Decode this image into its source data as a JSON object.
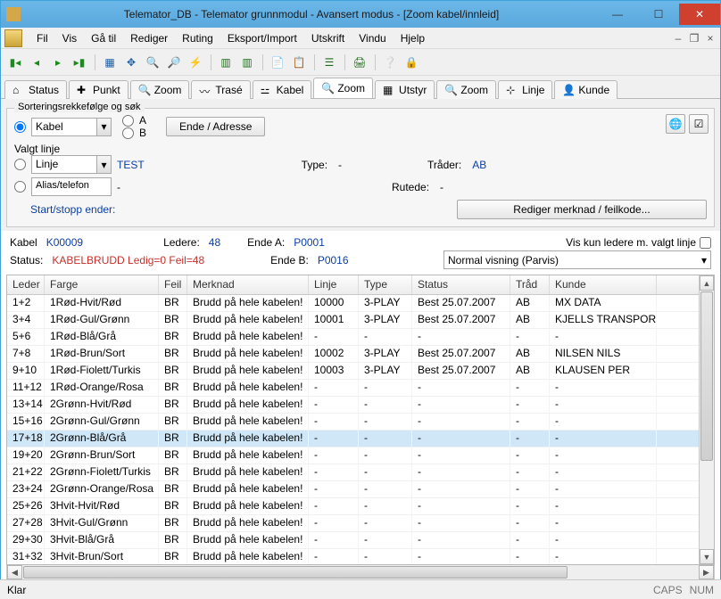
{
  "window": {
    "title": "Telemator_DB - Telemator grunnmodul - Avansert modus - [Zoom kabel/innleid]"
  },
  "menu": [
    "Fil",
    "Vis",
    "Gå til",
    "Rediger",
    "Ruting",
    "Eksport/Import",
    "Utskrift",
    "Vindu",
    "Hjelp"
  ],
  "tabs": [
    {
      "icon": "home",
      "label": "Status"
    },
    {
      "icon": "plus",
      "label": "Punkt"
    },
    {
      "icon": "zoom",
      "label": "Zoom"
    },
    {
      "icon": "trase",
      "label": "Trasé"
    },
    {
      "icon": "cable",
      "label": "Kabel"
    },
    {
      "icon": "zoom",
      "label": "Zoom",
      "active": true
    },
    {
      "icon": "eq",
      "label": "Utstyr"
    },
    {
      "icon": "zoom",
      "label": "Zoom"
    },
    {
      "icon": "line",
      "label": "Linje"
    },
    {
      "icon": "cust",
      "label": "Kunde"
    }
  ],
  "sortgroup": {
    "title": "Sorteringsrekkefølge og søk",
    "kabel_label": "Kabel",
    "A": "A",
    "B": "B",
    "ende_btn": "Ende / Adresse"
  },
  "valgt": {
    "title": "Valgt linje",
    "linje_label": "Linje",
    "linje_val": "TEST",
    "alias_label": "Alias/telefon",
    "alias_val": "-",
    "startstopp": "Start/stopp ender:",
    "type_lbl": "Type:",
    "type_val": "-",
    "trader_lbl": "Tråder:",
    "trader_val": "AB",
    "rutede_lbl": "Rutede:",
    "rutede_val": "-",
    "rediger_btn": "Rediger merknad / feilkode..."
  },
  "info": {
    "kabel_lbl": "Kabel",
    "kabel_val": "K00009",
    "ledere_lbl": "Ledere:",
    "ledere_val": "48",
    "endeA_lbl": "Ende A:",
    "endeA_val": "P0001",
    "endeB_lbl": "Ende B:",
    "endeB_val": "P0016",
    "status_lbl": "Status:",
    "status_val": "KABELBRUDD Ledig=0 Feil=48",
    "vis_kun": "Vis kun ledere m. valgt linje",
    "visning": "Normal visning (Parvis)"
  },
  "columns": [
    "Leder",
    "Farge",
    "Feil",
    "Merknad",
    "Linje",
    "Type",
    "Status",
    "Tråd",
    "Kunde"
  ],
  "rows": [
    {
      "leder": "1+2",
      "farge": "1Rød-Hvit/Rød",
      "feil": "BR",
      "merk": "Brudd på hele kabelen!",
      "linje": "10000",
      "type": "3-PLAY",
      "status": "Best 25.07.2007",
      "trad": "AB",
      "kunde": "MX DATA"
    },
    {
      "leder": "3+4",
      "farge": "1Rød-Gul/Grønn",
      "feil": "BR",
      "merk": "Brudd på hele kabelen!",
      "linje": "10001",
      "type": "3-PLAY",
      "status": "Best 25.07.2007",
      "trad": "AB",
      "kunde": "KJELLS TRANSPORT"
    },
    {
      "leder": "5+6",
      "farge": "1Rød-Blå/Grå",
      "feil": "BR",
      "merk": "Brudd på hele kabelen!",
      "linje": "-",
      "type": "-",
      "status": "-",
      "trad": "-",
      "kunde": "-"
    },
    {
      "leder": "7+8",
      "farge": "1Rød-Brun/Sort",
      "feil": "BR",
      "merk": "Brudd på hele kabelen!",
      "linje": "10002",
      "type": "3-PLAY",
      "status": "Best 25.07.2007",
      "trad": "AB",
      "kunde": "NILSEN NILS"
    },
    {
      "leder": "9+10",
      "farge": "1Rød-Fiolett/Turkis",
      "feil": "BR",
      "merk": "Brudd på hele kabelen!",
      "linje": "10003",
      "type": "3-PLAY",
      "status": "Best 25.07.2007",
      "trad": "AB",
      "kunde": "KLAUSEN PER"
    },
    {
      "leder": "11+12",
      "farge": "1Rød-Orange/Rosa",
      "feil": "BR",
      "merk": "Brudd på hele kabelen!",
      "linje": "-",
      "type": "-",
      "status": "-",
      "trad": "-",
      "kunde": "-"
    },
    {
      "leder": "13+14",
      "farge": "2Grønn-Hvit/Rød",
      "feil": "BR",
      "merk": "Brudd på hele kabelen!",
      "linje": "-",
      "type": "-",
      "status": "-",
      "trad": "-",
      "kunde": "-"
    },
    {
      "leder": "15+16",
      "farge": "2Grønn-Gul/Grønn",
      "feil": "BR",
      "merk": "Brudd på hele kabelen!",
      "linje": "-",
      "type": "-",
      "status": "-",
      "trad": "-",
      "kunde": "-"
    },
    {
      "leder": "17+18",
      "farge": "2Grønn-Blå/Grå",
      "feil": "BR",
      "merk": "Brudd på hele kabelen!",
      "linje": "-",
      "type": "-",
      "status": "-",
      "trad": "-",
      "kunde": "-",
      "sel": true
    },
    {
      "leder": "19+20",
      "farge": "2Grønn-Brun/Sort",
      "feil": "BR",
      "merk": "Brudd på hele kabelen!",
      "linje": "-",
      "type": "-",
      "status": "-",
      "trad": "-",
      "kunde": "-"
    },
    {
      "leder": "21+22",
      "farge": "2Grønn-Fiolett/Turkis",
      "feil": "BR",
      "merk": "Brudd på hele kabelen!",
      "linje": "-",
      "type": "-",
      "status": "-",
      "trad": "-",
      "kunde": "-"
    },
    {
      "leder": "23+24",
      "farge": "2Grønn-Orange/Rosa",
      "feil": "BR",
      "merk": "Brudd på hele kabelen!",
      "linje": "-",
      "type": "-",
      "status": "-",
      "trad": "-",
      "kunde": "-"
    },
    {
      "leder": "25+26",
      "farge": "3Hvit-Hvit/Rød",
      "feil": "BR",
      "merk": "Brudd på hele kabelen!",
      "linje": "-",
      "type": "-",
      "status": "-",
      "trad": "-",
      "kunde": "-"
    },
    {
      "leder": "27+28",
      "farge": "3Hvit-Gul/Grønn",
      "feil": "BR",
      "merk": "Brudd på hele kabelen!",
      "linje": "-",
      "type": "-",
      "status": "-",
      "trad": "-",
      "kunde": "-"
    },
    {
      "leder": "29+30",
      "farge": "3Hvit-Blå/Grå",
      "feil": "BR",
      "merk": "Brudd på hele kabelen!",
      "linje": "-",
      "type": "-",
      "status": "-",
      "trad": "-",
      "kunde": "-"
    },
    {
      "leder": "31+32",
      "farge": "3Hvit-Brun/Sort",
      "feil": "BR",
      "merk": "Brudd på hele kabelen!",
      "linje": "-",
      "type": "-",
      "status": "-",
      "trad": "-",
      "kunde": "-"
    }
  ],
  "statusbar": {
    "ready": "Klar",
    "caps": "CAPS",
    "num": "NUM"
  }
}
